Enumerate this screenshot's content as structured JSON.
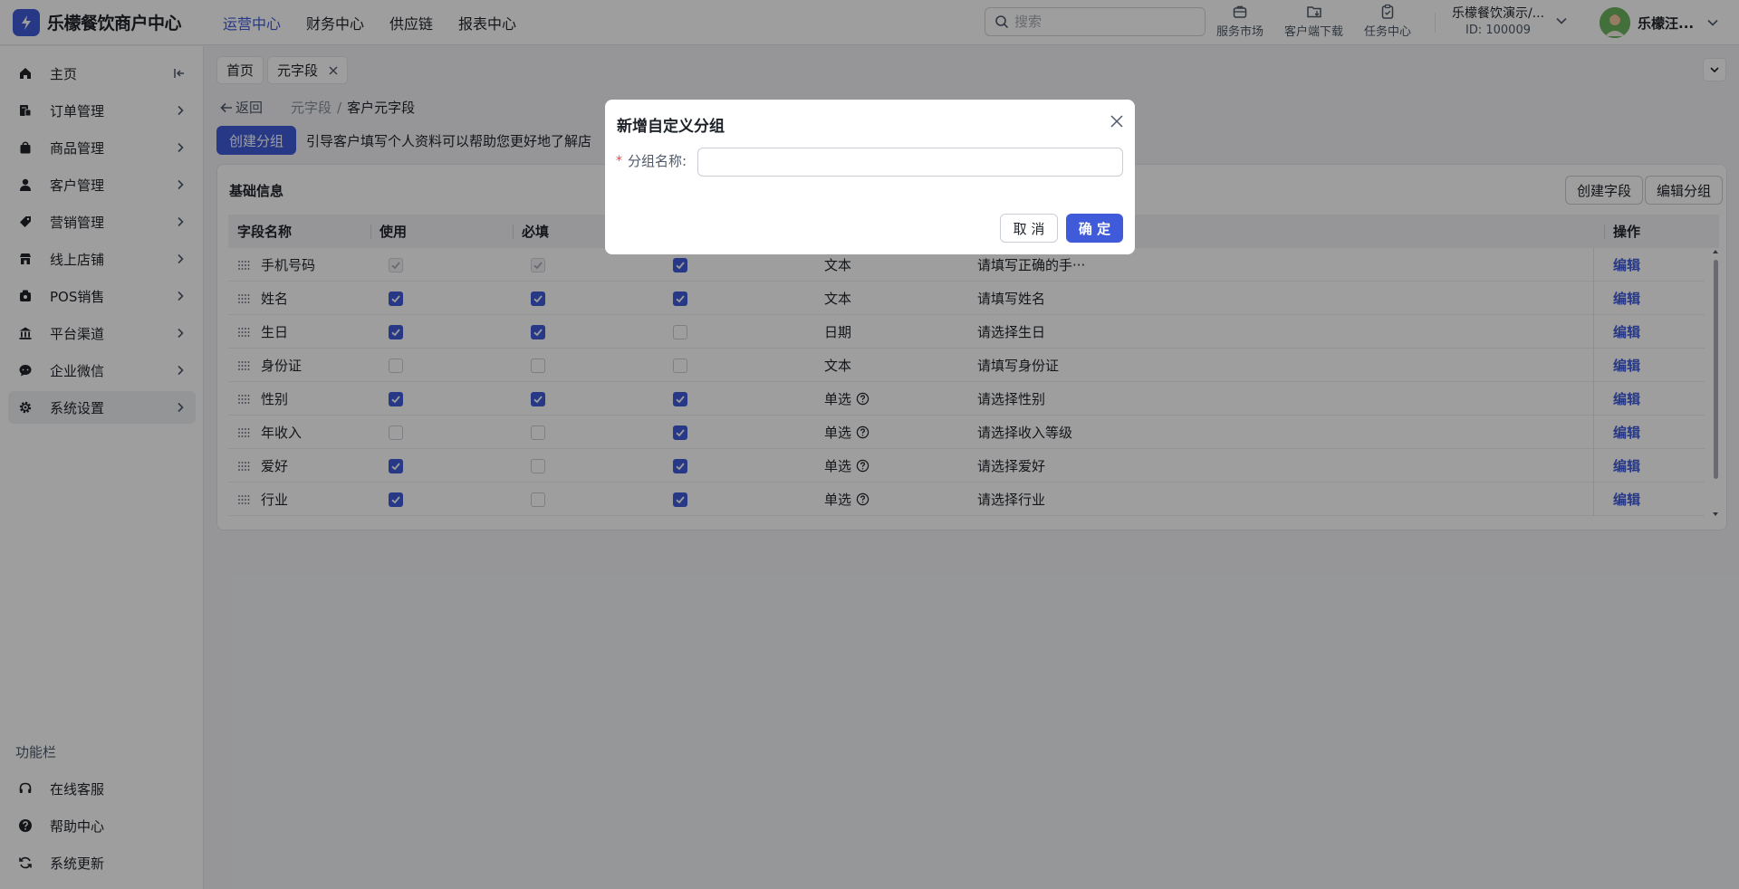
{
  "brand": {
    "name": "乐檬餐饮商户中心",
    "color": "#3f5bd9"
  },
  "topnav": [
    {
      "label": "运营中心",
      "active": true
    },
    {
      "label": "财务中心"
    },
    {
      "label": "供应链"
    },
    {
      "label": "报表中心"
    }
  ],
  "search": {
    "placeholder": "搜索"
  },
  "tools": [
    {
      "label": "服务市场",
      "icon": "briefcase-icon"
    },
    {
      "label": "客户端下载",
      "icon": "folder-download-icon"
    },
    {
      "label": "任务中心",
      "icon": "clipboard-icon"
    }
  ],
  "store": {
    "name": "乐檬餐饮演示/...",
    "id": "ID: 100009"
  },
  "user": {
    "name": "乐檬汪..."
  },
  "sidebar": {
    "items": [
      {
        "label": "主页",
        "icon": "home-icon"
      },
      {
        "label": "订单管理",
        "icon": "order-icon"
      },
      {
        "label": "商品管理",
        "icon": "bag-icon"
      },
      {
        "label": "客户管理",
        "icon": "user-icon"
      },
      {
        "label": "营销管理",
        "icon": "tag-icon"
      },
      {
        "label": "线上店铺",
        "icon": "store-icon"
      },
      {
        "label": "POS销售",
        "icon": "pos-icon"
      },
      {
        "label": "平台渠道",
        "icon": "bank-icon"
      },
      {
        "label": "企业微信",
        "icon": "chat-icon"
      },
      {
        "label": "系统设置",
        "icon": "gear-icon",
        "active": true
      }
    ],
    "section_title": "功能栏",
    "func_items": [
      {
        "label": "在线客服",
        "icon": "headset-icon"
      },
      {
        "label": "帮助中心",
        "icon": "help-icon"
      },
      {
        "label": "系统更新",
        "icon": "refresh-icon"
      }
    ]
  },
  "tabs": [
    {
      "label": "首页"
    },
    {
      "label": "元字段",
      "closable": true
    }
  ],
  "page": {
    "back_label": "返回",
    "breadcrumb": [
      "元字段",
      "客户元字段"
    ],
    "create_group_label": "创建分组",
    "guide_text": "引导客户填写个人资料可以帮助您更好地了解店"
  },
  "card": {
    "title": "基础信息",
    "create_field_label": "创建字段",
    "edit_group_label": "编辑分组",
    "columns": {
      "name": "字段名称",
      "use": "使用",
      "required": "必填",
      "op": "操作"
    },
    "edit_label": "编辑",
    "rows": [
      {
        "name": "手机号码",
        "use": true,
        "use_disabled": true,
        "required": true,
        "required_disabled": true,
        "third": true,
        "type": "文本",
        "hint": "请填写正确的手···"
      },
      {
        "name": "姓名",
        "use": true,
        "required": true,
        "third": true,
        "type": "文本",
        "hint": "请填写姓名"
      },
      {
        "name": "生日",
        "use": true,
        "required": true,
        "third": false,
        "type": "日期",
        "hint": "请选择生日"
      },
      {
        "name": "身份证",
        "use": false,
        "required": false,
        "third": false,
        "type": "文本",
        "hint": "请填写身份证"
      },
      {
        "name": "性别",
        "use": true,
        "required": true,
        "third": true,
        "type": "单选",
        "has_help": true,
        "hint": "请选择性别"
      },
      {
        "name": "年收入",
        "use": false,
        "required": false,
        "third": true,
        "type": "单选",
        "has_help": true,
        "hint": "请选择收入等级"
      },
      {
        "name": "爱好",
        "use": true,
        "required": false,
        "third": true,
        "type": "单选",
        "has_help": true,
        "hint": "请选择爱好"
      },
      {
        "name": "行业",
        "use": true,
        "required": false,
        "third": true,
        "type": "单选",
        "has_help": true,
        "hint": "请选择行业"
      }
    ]
  },
  "modal": {
    "title": "新增自定义分组",
    "required_mark": "*",
    "field_label": "分组名称:",
    "field_value": "",
    "cancel_label": "取 消",
    "ok_label": "确 定"
  }
}
